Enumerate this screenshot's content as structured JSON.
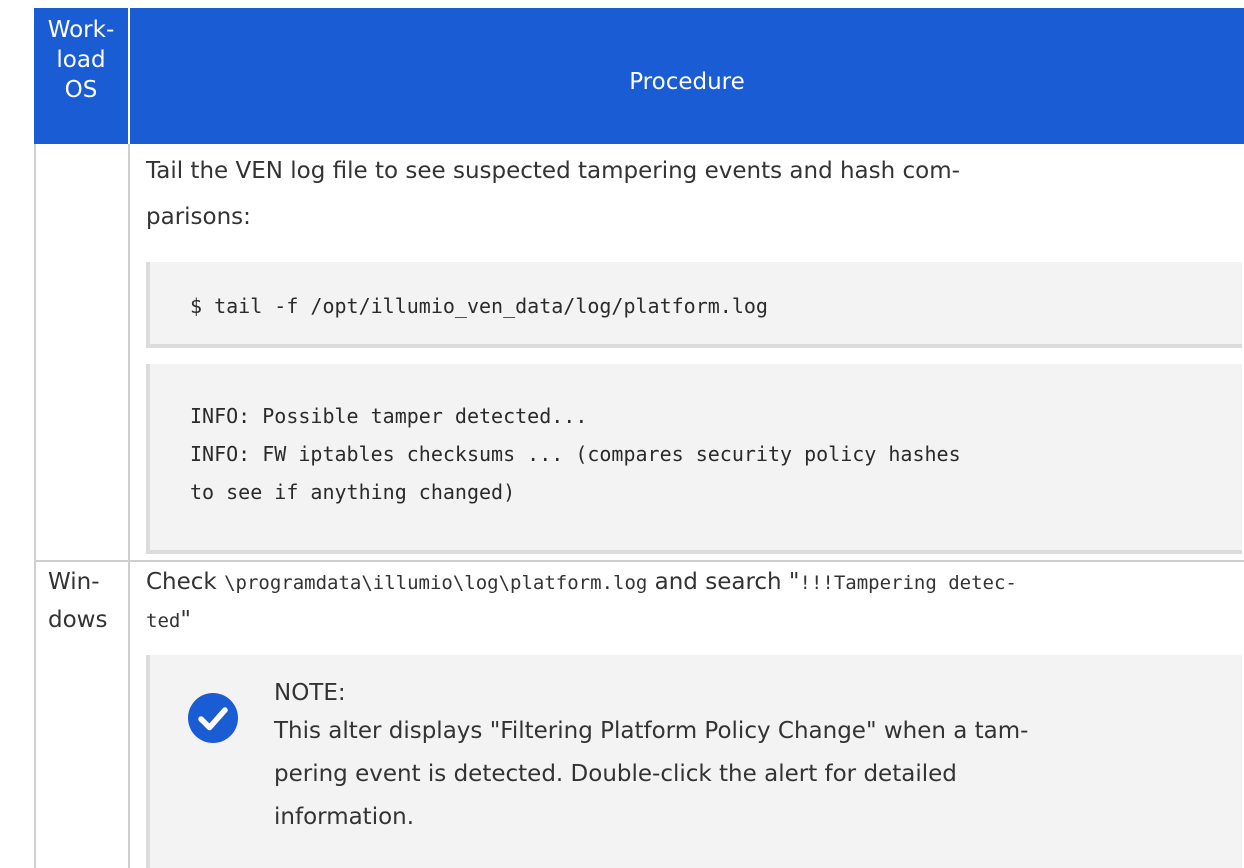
{
  "table": {
    "header": {
      "os_label_lines": [
        "Work-",
        "load",
        "OS"
      ],
      "procedure_label": "Procedure"
    },
    "rows": [
      {
        "os": "",
        "intro_line1": "Tail the VEN log file to see suspected tampering events and hash com-",
        "intro_line2": "parisons:",
        "command": "$ tail -f /opt/illumio_ven_data/log/platform.log",
        "output_lines": [
          "INFO: Possible tamper detected...",
          "INFO: FW iptables checksums ... (compares security policy hashes",
          "to see if anything changed)"
        ]
      },
      {
        "os_lines": [
          "Win-",
          "dows"
        ],
        "check_prefix": "Check ",
        "check_path": "\\programdata\\illumio\\log\\platform.log",
        "check_middle": " and search \"",
        "check_term_part1": "!!!Tampering detec-",
        "check_term_part2": "ted",
        "check_end": "\"",
        "note": {
          "icon": "check-circle-icon",
          "title": "NOTE:",
          "lines": [
            "This alter displays \"Filtering Platform Policy Change\" when a tam-",
            "pering event is detected. Double-click the alert for detailed",
            "information."
          ]
        }
      }
    ]
  },
  "colors": {
    "header_bg": "#1a5cd4",
    "header_text": "#ffffff",
    "code_bg": "#f3f3f3",
    "grid": "#cfcfcf",
    "icon": "#1a5cd4"
  }
}
